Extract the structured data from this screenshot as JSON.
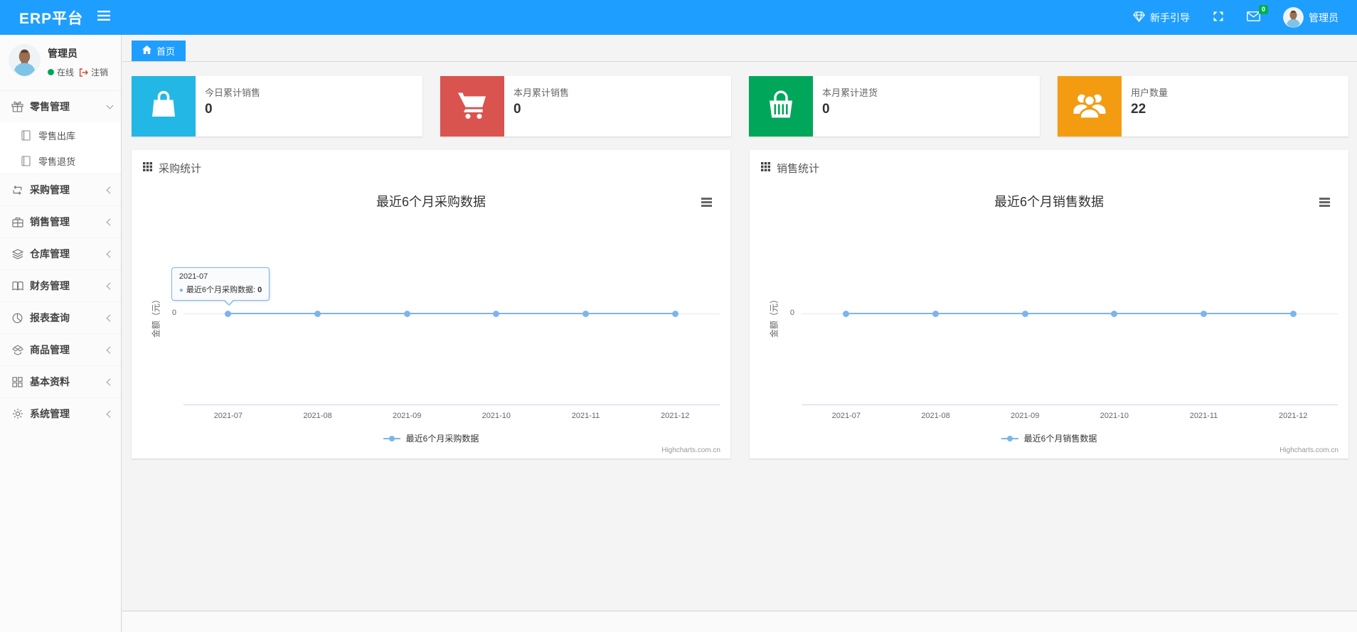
{
  "navbar": {
    "brand": "ERP平台",
    "guide_label": "新手引导",
    "mail_badge": "0",
    "badge_color": "#00b050",
    "user_name": "管理员"
  },
  "sidebar": {
    "user": {
      "name": "管理员",
      "status": "在线",
      "logout": "注销"
    },
    "menu": [
      {
        "label": "零售管理",
        "icon": "gift-icon",
        "expanded": true,
        "children": [
          {
            "label": "零售出库",
            "icon": "file-icon"
          },
          {
            "label": "零售退货",
            "icon": "file-icon"
          }
        ]
      },
      {
        "label": "采购管理",
        "icon": "repeat-icon",
        "expanded": false
      },
      {
        "label": "销售管理",
        "icon": "briefcase-icon",
        "expanded": false
      },
      {
        "label": "仓库管理",
        "icon": "layers-icon",
        "expanded": false
      },
      {
        "label": "财务管理",
        "icon": "book-icon",
        "expanded": false
      },
      {
        "label": "报表查询",
        "icon": "pie-chart-icon",
        "expanded": false
      },
      {
        "label": "商品管理",
        "icon": "box-icon",
        "expanded": false
      },
      {
        "label": "基本资料",
        "icon": "grid-icon",
        "expanded": false
      },
      {
        "label": "系统管理",
        "icon": "gear-icon",
        "expanded": false
      }
    ]
  },
  "tabs": {
    "home_label": "首页"
  },
  "stat_cards": [
    {
      "label": "今日累计销售",
      "value": "0",
      "icon": "shopping-bag-icon",
      "color": "#23b7e5"
    },
    {
      "label": "本月累计销售",
      "value": "0",
      "icon": "shopping-cart-icon",
      "color": "#d9534f"
    },
    {
      "label": "本月累计进货",
      "value": "0",
      "icon": "shopping-basket-icon",
      "color": "#00a65a"
    },
    {
      "label": "用户数量",
      "value": "22",
      "icon": "users-icon",
      "color": "#f39c12"
    }
  ],
  "panels": [
    {
      "header": "采购统计"
    },
    {
      "header": "销售统计"
    }
  ],
  "chart_data": [
    {
      "type": "line",
      "title": "最近6个月采购数据",
      "categories": [
        "2021-07",
        "2021-08",
        "2021-09",
        "2021-10",
        "2021-11",
        "2021-12"
      ],
      "series": [
        {
          "name": "最近6个月采购数据",
          "values": [
            0,
            0,
            0,
            0,
            0,
            0
          ],
          "color": "#7cb5ec"
        }
      ],
      "ylabel": "金额（元）",
      "yticks": [
        "0"
      ],
      "ylim": [
        0,
        1
      ],
      "grid": true,
      "legend_position": "bottom",
      "credits": "Highcharts.com.cn",
      "tooltip": {
        "visible": true,
        "category": "2021-07",
        "series": "最近6个月采购数据",
        "value": "0"
      }
    },
    {
      "type": "line",
      "title": "最近6个月销售数据",
      "categories": [
        "2021-07",
        "2021-08",
        "2021-09",
        "2021-10",
        "2021-11",
        "2021-12"
      ],
      "series": [
        {
          "name": "最近6个月销售数据",
          "values": [
            0,
            0,
            0,
            0,
            0,
            0
          ],
          "color": "#7cb5ec"
        }
      ],
      "ylabel": "金额（元）",
      "yticks": [
        "0"
      ],
      "ylim": [
        0,
        1
      ],
      "grid": true,
      "legend_position": "bottom",
      "credits": "Highcharts.com.cn",
      "tooltip": {
        "visible": false
      }
    }
  ]
}
